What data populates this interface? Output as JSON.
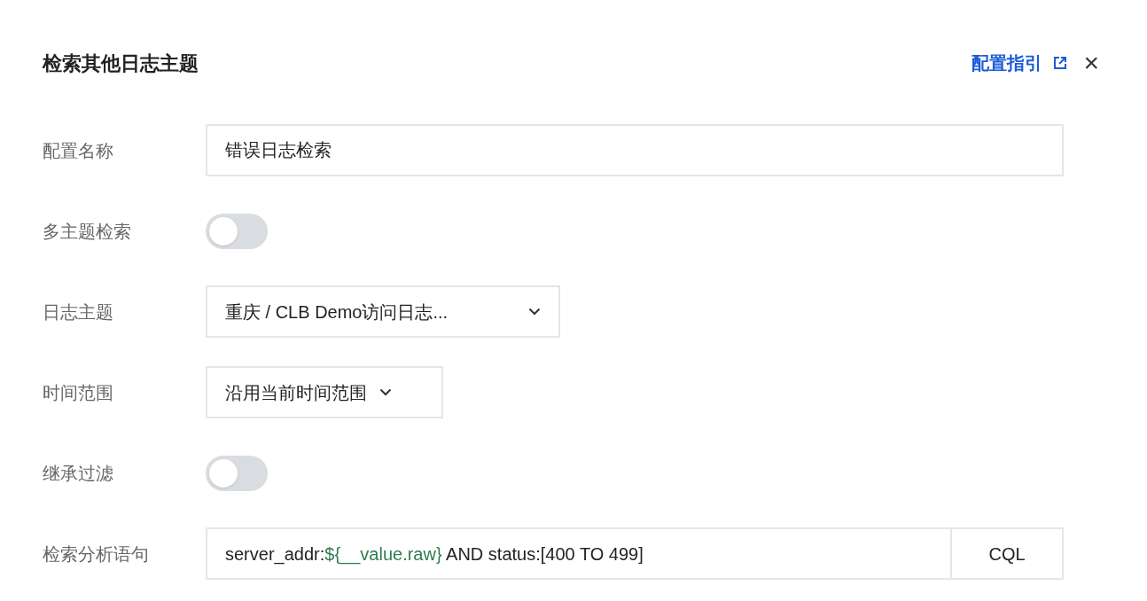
{
  "dialog": {
    "title": "检索其他日志主题",
    "guide_link": "配置指引",
    "close": "×"
  },
  "fields": [
    {
      "kind": "text",
      "label": "配置名称",
      "value": "错误日志检索"
    },
    {
      "kind": "toggle",
      "label": "多主题检索",
      "on": false
    },
    {
      "kind": "select",
      "label": "日志主题",
      "value": "重庆 / CLB Demo访问日志...",
      "wide": true
    },
    {
      "kind": "select",
      "label": "时间范围",
      "value": "沿用当前时间范围",
      "wide": false
    },
    {
      "kind": "toggle",
      "label": "继承过滤",
      "on": false
    },
    {
      "kind": "query",
      "label": "检索分析语句",
      "segments": [
        {
          "kind": "plain",
          "text": "server_addr:"
        },
        {
          "kind": "variable",
          "text": "${__value.raw}"
        },
        {
          "kind": "plain",
          "text": " AND status:[400 TO 499]"
        }
      ],
      "syntax": "CQL"
    }
  ]
}
